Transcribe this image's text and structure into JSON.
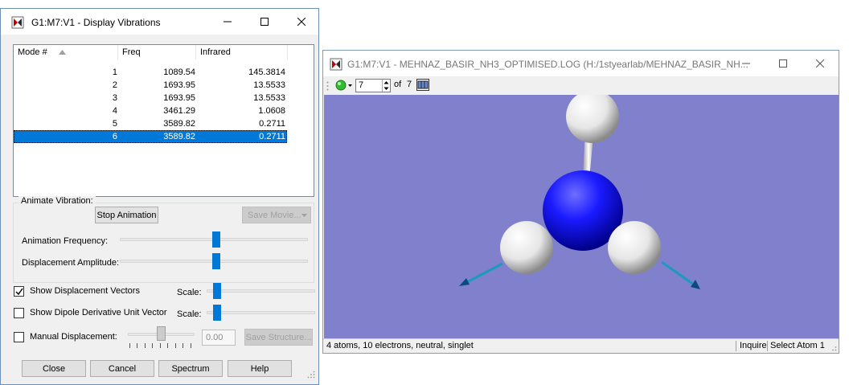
{
  "dialog": {
    "title": "G1:M7:V1 - Display Vibrations",
    "table": {
      "headers": [
        "Mode #",
        "Freq",
        "Infrared"
      ],
      "rows": [
        [
          "1",
          "1089.54",
          "145.3814"
        ],
        [
          "2",
          "1693.95",
          "13.5533"
        ],
        [
          "3",
          "1693.95",
          "13.5533"
        ],
        [
          "4",
          "3461.29",
          "1.0608"
        ],
        [
          "5",
          "3589.82",
          "0.2711"
        ],
        [
          "6",
          "3589.82",
          "0.2711"
        ]
      ],
      "selected_mode": "6"
    },
    "animate": {
      "group_label": "Animate Vibration:",
      "stop_button": "Stop Animation",
      "save_movie_button": "Save Movie...",
      "frequency_label": "Animation Frequency:",
      "amplitude_label": "Displacement Amplitude:",
      "frequency_value": 0.49,
      "amplitude_value": 0.49
    },
    "options": {
      "show_vectors_label": "Show Displacement Vectors",
      "show_vectors_checked": true,
      "show_dipole_label": "Show Dipole Derivative Unit Vector",
      "show_dipole_checked": false,
      "scale_label": "Scale:",
      "vector_scale_value": 0.06,
      "dipole_scale_value": 0.06,
      "manual_label": "Manual Displacement:",
      "manual_checked": false,
      "manual_value": "0.00",
      "save_structure_button": "Save Structure..."
    },
    "buttons": {
      "close": "Close",
      "cancel": "Cancel",
      "spectrum": "Spectrum",
      "help": "Help"
    }
  },
  "viewer": {
    "title": "G1:M7:V1 - MEHNAZ_BASIR_NH3_OPTIMISED.LOG (H:/1styearlab/MEHNAZ_BASIR_NH...",
    "frame_value": "7",
    "of_label": "of",
    "frame_total": "7",
    "status_text": "4 atoms, 10 electrons, neutral, singlet",
    "status_inquire": "Inquire",
    "status_select": "Select Atom 1",
    "background_color": "#8080cc",
    "atom_colors": {
      "nitrogen": "#1a1aff",
      "hydrogen": "#f2f2f2",
      "vector": "#1a9ac0"
    }
  }
}
